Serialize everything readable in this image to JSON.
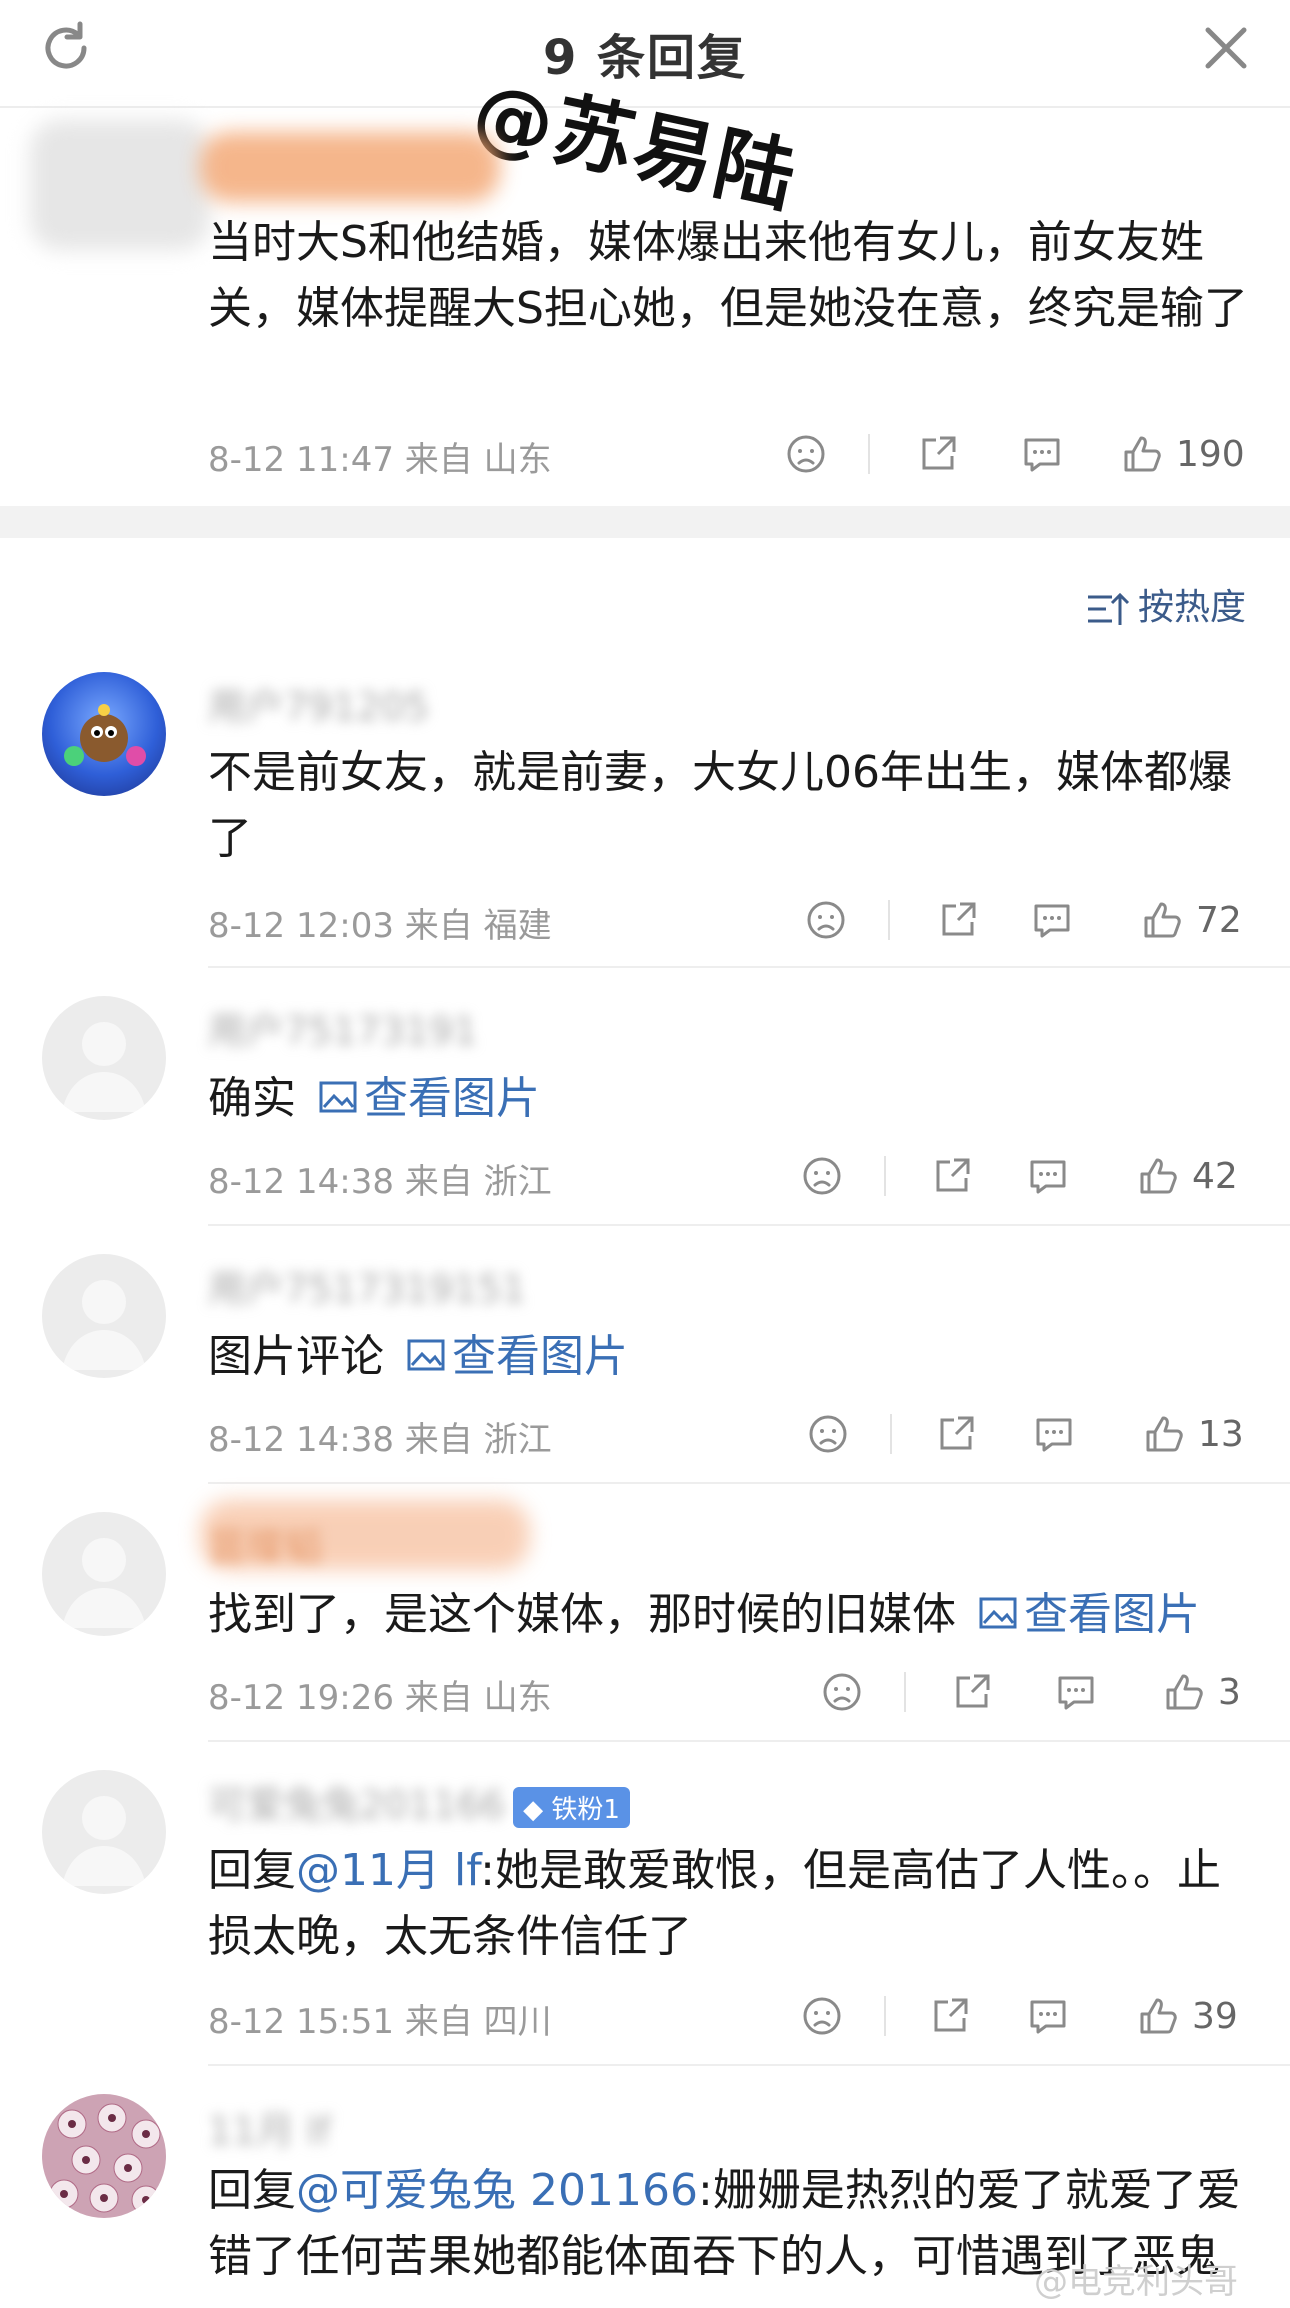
{
  "header": {
    "title": "9 条回复"
  },
  "watermark": "@苏易陆",
  "main_comment": {
    "text": "当时大S和他结婚，媒体爆出来他有女儿，前女友姓关，媒体提醒大S担心她，但是她没在意，终究是输了",
    "meta": "8-12 11:47  来自 山东",
    "likes": "190"
  },
  "sort_label": "按热度",
  "replies": [
    {
      "username": "用户791205",
      "text": "不是前女友，就是前妻，大女儿06年出生，媒体都爆了",
      "meta": "8-12 12:03  来自 福建",
      "likes": "72"
    },
    {
      "username": "用户75173191",
      "text": "确实",
      "pic_link": "查看图片",
      "meta": "8-12 14:38  来自 浙江",
      "likes": "42"
    },
    {
      "username": "用户7517319151",
      "text": "图片评论",
      "pic_link": "查看图片",
      "meta": "8-12 14:38  来自 浙江",
      "likes": "13"
    },
    {
      "username": "昙璨韬",
      "text": "找到了，是这个媒体，那时候的旧媒体",
      "pic_link": "查看图片",
      "meta": "8-12 19:26  来自 山东",
      "likes": "3"
    },
    {
      "username": "可爱兔兔201166",
      "badge": "铁粉1",
      "reply_prefix": "回复",
      "mention": "@11月 lf",
      "text": ":她是敢爱敢恨，但是高估了人性。。止损太晚，太无条件信任了",
      "meta": "8-12 15:51  来自 四川",
      "likes": "39"
    },
    {
      "username": "11月 lf",
      "reply_prefix": "回复",
      "mention": "@可爱兔兔 201166",
      "text": ":姗姗是热烈的爱了就爱了爱错了任何苦果她都能体面吞下的人，可惜遇到了恶鬼"
    }
  ],
  "footer_watermark": "@电竞利头哥",
  "colors": {
    "link": "#3a6fb5",
    "meta": "#9a9a9a",
    "badge": "#5a92e6"
  }
}
